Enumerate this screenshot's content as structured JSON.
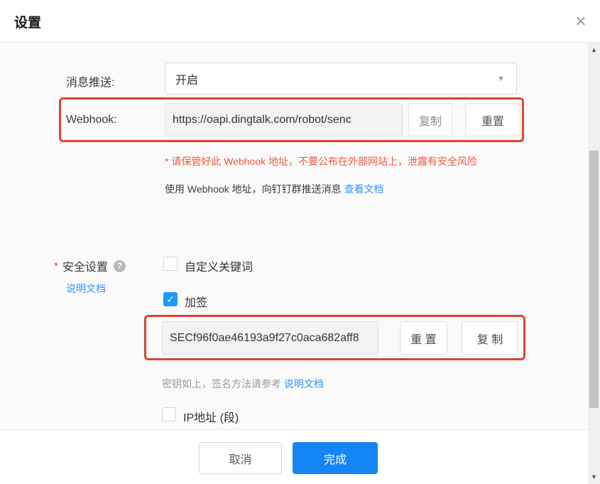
{
  "dialog": {
    "title": "设置"
  },
  "icons": {
    "close": "✕",
    "chevron_down": "▼",
    "help": "?",
    "check": "✓",
    "scroll_up": "▲",
    "scroll_down": "▼"
  },
  "colors": {
    "annotation_red": "#df4334",
    "warning_red": "#f25643",
    "link_blue": "#3296fa",
    "accent_blue": "#1585f5",
    "checkbox_blue": "#1a9bfc"
  },
  "message_push": {
    "label": "消息推送:",
    "value": "开启"
  },
  "webhook": {
    "label": "Webhook:",
    "value": "https://oapi.dingtalk.com/robot/senc",
    "copy_label": "复制",
    "reset_label": "重置",
    "warning": "* 请保管好此 Webhook 地址，不要公布在外部网站上，泄露有安全风险",
    "usage_text": "使用 Webhook 地址，向钉钉群推送消息 ",
    "usage_link": "查看文档"
  },
  "security": {
    "required_mark": "*",
    "label": "安全设置",
    "doc_link": "说明文档",
    "options": [
      {
        "label": "自定义关键词",
        "checked": false
      },
      {
        "label": "加签",
        "checked": true
      },
      {
        "label": "IP地址 (段)",
        "checked": false
      }
    ],
    "sign": {
      "value": "SECf96f0ae46193a9f27c0aca682aff8",
      "reset_label": "重 置",
      "copy_label": "复 制",
      "note_text": "密钥如上，签名方法请参考 ",
      "note_link": "说明文档"
    }
  },
  "footer": {
    "cancel_label": "取消",
    "done_label": "完成"
  }
}
